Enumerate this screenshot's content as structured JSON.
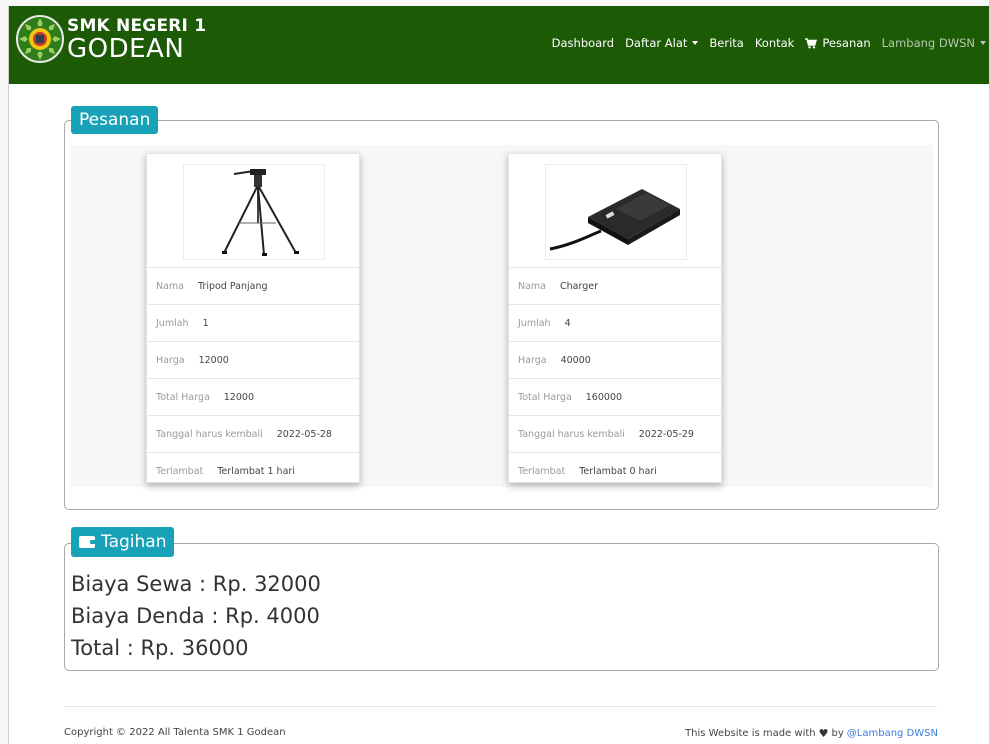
{
  "brand": {
    "line1": "SMK NEGERI 1",
    "line2": "GODEAN"
  },
  "nav": {
    "dashboard": "Dashboard",
    "daftar_alat": "Daftar Alat",
    "berita": "Berita",
    "kontak": "Kontak",
    "pesanan": "Pesanan",
    "user": "Lambang DWSN"
  },
  "pesanan": {
    "legend": "Pesanan",
    "items": [
      {
        "image": "tripod-image",
        "rows": [
          {
            "label": "Nama",
            "value": "Tripod Panjang"
          },
          {
            "label": "Jumlah",
            "value": "1"
          },
          {
            "label": "Harga",
            "value": "12000"
          },
          {
            "label": "Total Harga",
            "value": "12000"
          },
          {
            "label": "Tanggal harus kembali",
            "value": "2022-05-28"
          },
          {
            "label": "Terlambat",
            "value": "Terlambat 1 hari"
          }
        ]
      },
      {
        "image": "charger-image",
        "rows": [
          {
            "label": "Nama",
            "value": "Charger"
          },
          {
            "label": "Jumlah",
            "value": "4"
          },
          {
            "label": "Harga",
            "value": "40000"
          },
          {
            "label": "Total Harga",
            "value": "160000"
          },
          {
            "label": "Tanggal harus kembali",
            "value": "2022-05-29"
          },
          {
            "label": "Terlambat",
            "value": "Terlambat 0 hari"
          }
        ]
      }
    ]
  },
  "tagihan": {
    "legend": "Tagihan",
    "biaya_sewa": "Biaya Sewa : Rp. 32000",
    "biaya_denda": "Biaya Denda : Rp. 4000",
    "total": "Total : Rp. 36000"
  },
  "footer": {
    "copyright": "Copyright © 2022 All Talenta SMK 1 Godean",
    "made_with": "This Website is made with",
    "by": "by",
    "author": "@Lambang DWSN"
  },
  "colors": {
    "navbar": "#1c5a06",
    "legend": "#17a2b8",
    "link": "#3b7ddd"
  }
}
